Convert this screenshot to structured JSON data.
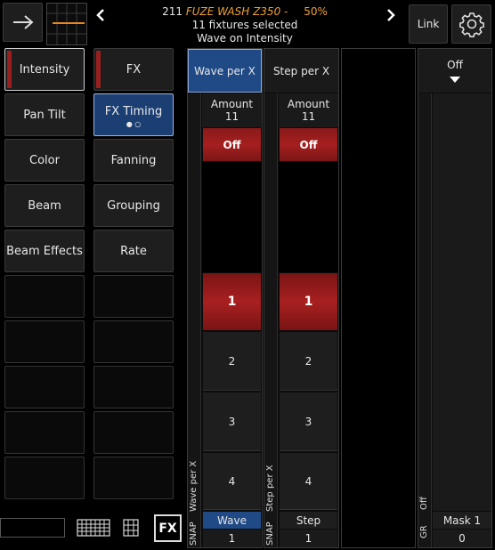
{
  "header": {
    "fixture_count": "211",
    "fixture_name": "FUZE WASH Z350",
    "separator": "-",
    "intensity": "50%",
    "selection_text": "11 fixtures selected",
    "mode_text": "Wave on Intensity",
    "link_label": "Link",
    "accent_color": "#f0a030"
  },
  "left_buttons": [
    "Intensity",
    "Pan Tilt",
    "Color",
    "Beam",
    "Beam Effects"
  ],
  "right_buttons": [
    "FX",
    "FX Timing",
    "Fanning",
    "Grouping",
    "Rate"
  ],
  "columns": {
    "wave": {
      "title": "Wave per X",
      "amount_label": "Amount",
      "amount_value": "11",
      "off_label": "Off",
      "steps": [
        "1",
        "2",
        "3",
        "4"
      ],
      "vertical_label": "Wave per X",
      "snap_label": "SNAP",
      "bottom_label": "Wave",
      "bottom_value": "1"
    },
    "step": {
      "title": "Step per X",
      "amount_label": "Amount",
      "amount_value": "11",
      "off_label": "Off",
      "steps": [
        "1",
        "2",
        "3",
        "4"
      ],
      "vertical_label": "Step per X",
      "snap_label": "SNAP",
      "bottom_label": "Step",
      "bottom_value": "1"
    },
    "mask": {
      "title": "Off",
      "vertical_label": "Off",
      "gr_label": "GR",
      "bottom_label": "Mask 1",
      "bottom_value": "0"
    }
  },
  "footer": {
    "fx_label": "FX"
  },
  "icons": [
    "arrow-right-icon",
    "chevron-left-icon",
    "chevron-right-icon",
    "gear-icon",
    "keyboard-icon",
    "grid-icon",
    "triangle-down-icon"
  ]
}
